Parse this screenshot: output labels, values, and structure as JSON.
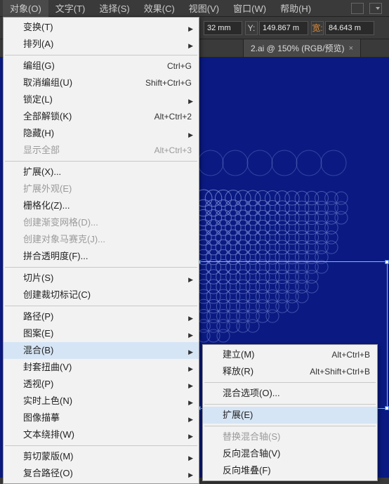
{
  "menubar": {
    "items": [
      "对象(O)",
      "文字(T)",
      "选择(S)",
      "效果(C)",
      "视图(V)",
      "窗口(W)",
      "帮助(H)"
    ]
  },
  "toolbar": {
    "unit_x": "32 mm",
    "label_y": "Y:",
    "val_y": "149.867 m",
    "label_w": "宽:",
    "val_w": "84.643 m"
  },
  "tabs": {
    "tab0": {
      "label": "2.ai @ 150% (RGB/预览)",
      "close": "×"
    }
  },
  "object_menu": [
    {
      "label": "变换(T)",
      "sub": true
    },
    {
      "label": "排列(A)",
      "sub": true
    },
    {
      "sep": true
    },
    {
      "label": "编组(G)",
      "shortcut": "Ctrl+G"
    },
    {
      "label": "取消编组(U)",
      "shortcut": "Shift+Ctrl+G"
    },
    {
      "label": "锁定(L)",
      "sub": true
    },
    {
      "label": "全部解锁(K)",
      "shortcut": "Alt+Ctrl+2"
    },
    {
      "label": "隐藏(H)",
      "sub": true
    },
    {
      "label": "显示全部",
      "shortcut": "Alt+Ctrl+3",
      "disabled": true
    },
    {
      "sep": true
    },
    {
      "label": "扩展(X)..."
    },
    {
      "label": "扩展外观(E)",
      "disabled": true
    },
    {
      "label": "栅格化(Z)..."
    },
    {
      "label": "创建渐变网格(D)...",
      "disabled": true
    },
    {
      "label": "创建对象马赛克(J)...",
      "disabled": true
    },
    {
      "label": "拼合透明度(F)..."
    },
    {
      "sep": true
    },
    {
      "label": "切片(S)",
      "sub": true
    },
    {
      "label": "创建裁切标记(C)"
    },
    {
      "sep": true
    },
    {
      "label": "路径(P)",
      "sub": true
    },
    {
      "label": "图案(E)",
      "sub": true
    },
    {
      "label": "混合(B)",
      "sub": true,
      "highlight": true
    },
    {
      "label": "封套扭曲(V)",
      "sub": true
    },
    {
      "label": "透视(P)",
      "sub": true
    },
    {
      "label": "实时上色(N)",
      "sub": true
    },
    {
      "label": "图像描摹",
      "sub": true
    },
    {
      "label": "文本绕排(W)",
      "sub": true
    },
    {
      "sep": true
    },
    {
      "label": "剪切蒙版(M)",
      "sub": true
    },
    {
      "label": "复合路径(O)",
      "sub": true
    }
  ],
  "blend_submenu": [
    {
      "label": "建立(M)",
      "shortcut": "Alt+Ctrl+B"
    },
    {
      "label": "释放(R)",
      "shortcut": "Alt+Shift+Ctrl+B"
    },
    {
      "sep": true
    },
    {
      "label": "混合选项(O)..."
    },
    {
      "sep": true
    },
    {
      "label": "扩展(E)",
      "highlight": true
    },
    {
      "sep": true
    },
    {
      "label": "替换混合轴(S)",
      "disabled": true
    },
    {
      "label": "反向混合轴(V)"
    },
    {
      "label": "反向堆叠(F)"
    }
  ]
}
